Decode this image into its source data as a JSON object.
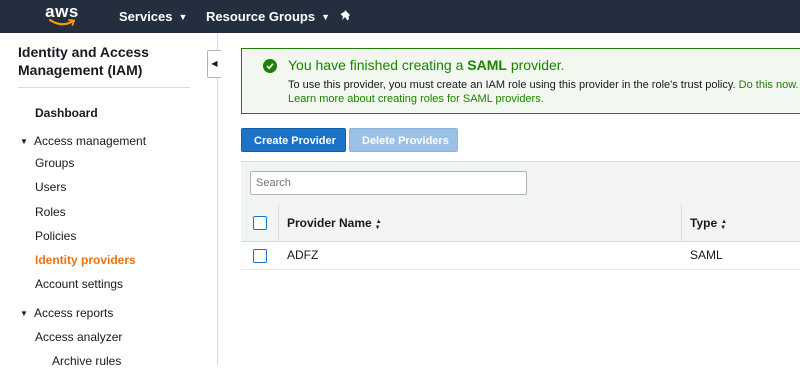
{
  "topnav": {
    "logo_text": "aws",
    "services_label": "Services",
    "resource_groups_label": "Resource Groups"
  },
  "sidebar": {
    "title": "Identity and Access Management (IAM)",
    "dashboard": "Dashboard",
    "access_management": "Access management",
    "items": [
      "Groups",
      "Users",
      "Roles",
      "Policies",
      "Identity providers",
      "Account settings"
    ],
    "access_reports": "Access reports",
    "report_items": [
      "Access analyzer",
      "Archive rules"
    ]
  },
  "flash": {
    "title_prefix": "You have finished creating a",
    "title_bold": "SAML",
    "title_suffix": "provider.",
    "line1_text": "To use this provider, you must create an IAM role using this provider in the role's trust policy.",
    "line1_link": "Do this now.",
    "line2_link": "Learn more about creating roles for SAML providers."
  },
  "buttons": {
    "create": "Create Provider",
    "delete": "Delete Providers"
  },
  "search": {
    "placeholder": "Search"
  },
  "table": {
    "columns": [
      "Provider Name",
      "Type"
    ],
    "rows": [
      {
        "name": "ADFZ",
        "type": "SAML"
      }
    ]
  },
  "colors": {
    "nav_bg": "#232f3e",
    "active_link": "#ec7211",
    "success": "#1d8102",
    "primary": "#1a73c7"
  }
}
